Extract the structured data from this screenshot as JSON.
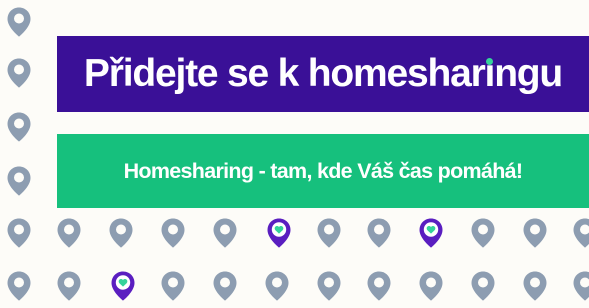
{
  "headline": {
    "text_before_dot": "Přidejte se k homeshar",
    "dotted_letter": "ı",
    "text_after_dot": "ngu",
    "background": "#3a1097"
  },
  "tagline": {
    "text": "Homesharing - tam, kde Váš čas pomáhá!",
    "background": "#16c07d"
  },
  "pattern": {
    "pin_icon": "map-pin-icon",
    "highlighted_pin_icon": "map-pin-heart-icon",
    "pin_color": "#8d9db1",
    "highlight_color": "#5a1ec0",
    "heart_color": "#35d39a"
  }
}
